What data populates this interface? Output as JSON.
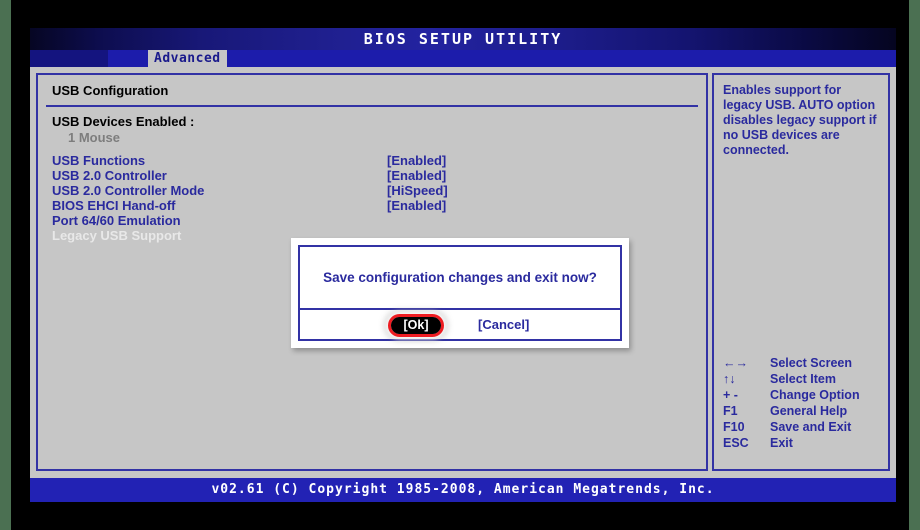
{
  "window": {
    "title": "BIOS SETUP UTILITY",
    "footer": "v02.61 (C) Copyright 1985-2008, American Megatrends, Inc."
  },
  "tabs": [
    {
      "label": "Advanced",
      "active": true
    }
  ],
  "main": {
    "panel_title": "USB Configuration",
    "devices_label": "USB Devices Enabled :",
    "devices_value": "1 Mouse",
    "options": [
      {
        "label": "USB Functions",
        "value": "[Enabled]",
        "selected": false
      },
      {
        "label": "USB 2.0 Controller",
        "value": "[Enabled]",
        "selected": false
      },
      {
        "label": "USB 2.0 Controller Mode",
        "value": "[HiSpeed]",
        "selected": false
      },
      {
        "label": "BIOS EHCI Hand-off",
        "value": "[Enabled]",
        "selected": false
      },
      {
        "label": "Port 64/60 Emulation",
        "value": "",
        "selected": false
      },
      {
        "label": "Legacy USB Support",
        "value": "",
        "selected": true
      }
    ]
  },
  "help": {
    "text": "Enables support for legacy USB. AUTO option disables legacy support if no USB devices are connected."
  },
  "legend": [
    {
      "key": "←→",
      "desc": "Select Screen"
    },
    {
      "key": "↑↓",
      "desc": "Select Item"
    },
    {
      "key": "+ -",
      "desc": "Change Option"
    },
    {
      "key": "F1",
      "desc": "General Help"
    },
    {
      "key": "F10",
      "desc": "Save and Exit"
    },
    {
      "key": "ESC",
      "desc": "Exit"
    }
  ],
  "dialog": {
    "message": "Save configuration changes and exit now?",
    "ok_label": "[Ok]",
    "cancel_label": "[Cancel]",
    "highlight_color": "#ee1c22"
  },
  "colors": {
    "screen_bg": "#c6c6c6",
    "accent_blue": "#2a2a9e",
    "border_blue": "#3232a5",
    "title_bar": "#1c1cab",
    "footer_bar": "#2222b4",
    "selected_text": "#e8e8e8",
    "muted_text": "#7d7d7d"
  }
}
